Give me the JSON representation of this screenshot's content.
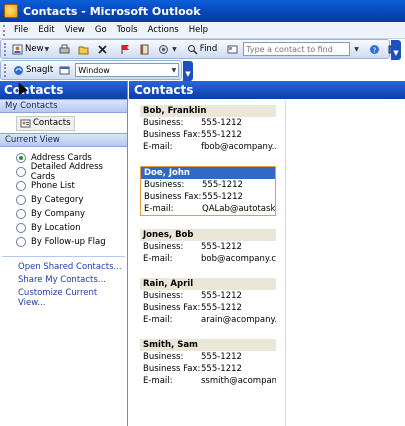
{
  "window": {
    "title": "Contacts - Microsoft Outlook"
  },
  "menu": [
    "File",
    "Edit",
    "View",
    "Go",
    "Tools",
    "Actions",
    "Help"
  ],
  "toolbar": {
    "new_label": "New",
    "find_label": "Find",
    "search_placeholder": "Type a contact to find"
  },
  "toolbar2": {
    "snagit_label": "SnagIt",
    "window_select_value": "Window"
  },
  "nav": {
    "header": "Contacts",
    "my_contacts_header": "My Contacts",
    "my_contacts_item": "Contacts",
    "current_view_header": "Current View",
    "views": [
      {
        "label": "Address Cards",
        "selected": true
      },
      {
        "label": "Detailed Address Cards",
        "selected": false
      },
      {
        "label": "Phone List",
        "selected": false
      },
      {
        "label": "By Category",
        "selected": false
      },
      {
        "label": "By Company",
        "selected": false
      },
      {
        "label": "By Location",
        "selected": false
      },
      {
        "label": "By Follow-up Flag",
        "selected": false
      }
    ],
    "links": [
      "Open Shared Contacts...",
      "Share My Contacts...",
      "Customize Current View..."
    ]
  },
  "main": {
    "header": "Contacts",
    "labels": {
      "business": "Business:",
      "fax": "Business Fax:",
      "email": "E-mail:"
    },
    "cards": [
      {
        "name": "Bob, Franklin",
        "business": "555-1212",
        "fax": "555-1212",
        "email": "fbob@acompany...."
      },
      {
        "name": "Doe, John",
        "business": "555-1212",
        "fax": "555-1212",
        "email": "QALab@autotask....",
        "selected": true
      },
      {
        "name": "Jones, Bob",
        "business": "555-1212",
        "email": "bob@acompany.c..."
      },
      {
        "name": "Rain, April",
        "business": "555-1212",
        "fax": "555-1212",
        "email": "arain@acompany...."
      },
      {
        "name": "Smith, Sam",
        "business": "555-1212",
        "fax": "555-1212",
        "email": "ssmith@acompan..."
      }
    ]
  }
}
